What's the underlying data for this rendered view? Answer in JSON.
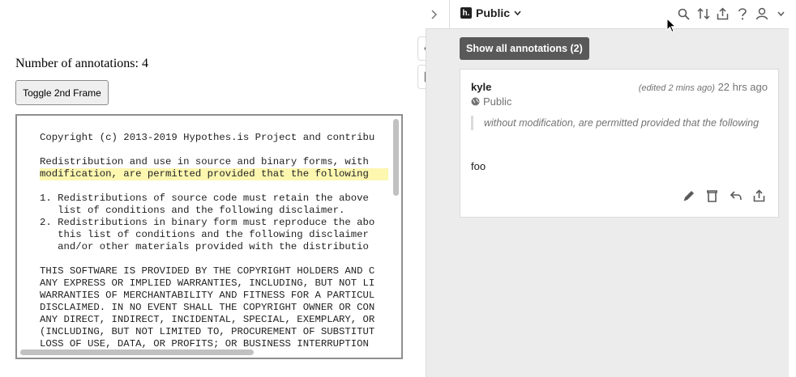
{
  "page": {
    "annotation_count_text": "Number of annotations: 4",
    "toggle_button_label": "Toggle 2nd Frame"
  },
  "frame": {
    "lines": [
      "Copyright (c) 2013-2019 Hypothes.is Project and contribu",
      "",
      "Redistribution and use in source and binary forms, with",
      "modification, are permitted provided that the following",
      "",
      "1. Redistributions of source code must retain the above",
      "   list of conditions and the following disclaimer.",
      "2. Redistributions in binary form must reproduce the abo",
      "   this list of conditions and the following disclaimer",
      "   and/or other materials provided with the distributio",
      "",
      "THIS SOFTWARE IS PROVIDED BY THE COPYRIGHT HOLDERS AND C",
      "ANY EXPRESS OR IMPLIED WARRANTIES, INCLUDING, BUT NOT LI",
      "WARRANTIES OF MERCHANTABILITY AND FITNESS FOR A PARTICUL",
      "DISCLAIMED. IN NO EVENT SHALL THE COPYRIGHT OWNER OR CON",
      "ANY DIRECT, INDIRECT, INCIDENTAL, SPECIAL, EXEMPLARY, OR",
      "(INCLUDING, BUT NOT LIMITED TO, PROCUREMENT OF SUBSTITUT",
      "LOSS OF USE, DATA, OR PROFITS; OR BUSINESS INTERRUPTION"
    ],
    "highlighted_line_index": 3
  },
  "sidebar": {
    "scope_label": "Public",
    "logo_text": "h.",
    "top_icons": [
      "search-icon",
      "sort-icon",
      "share-icon",
      "help-icon",
      "user-icon",
      "chevron-down-icon"
    ],
    "side_tabs": [
      "eye-icon",
      "note-icon"
    ],
    "show_all_label": "Show all annotations (2)",
    "annotation": {
      "user": "kyle",
      "privacy": "Public",
      "edited": "(edited 2 mins ago)",
      "time": "22 hrs ago",
      "quote": "without modification, are permitted provided that the following",
      "text": "foo",
      "actions": [
        "edit-icon",
        "delete-icon",
        "reply-icon",
        "share-icon"
      ]
    }
  }
}
